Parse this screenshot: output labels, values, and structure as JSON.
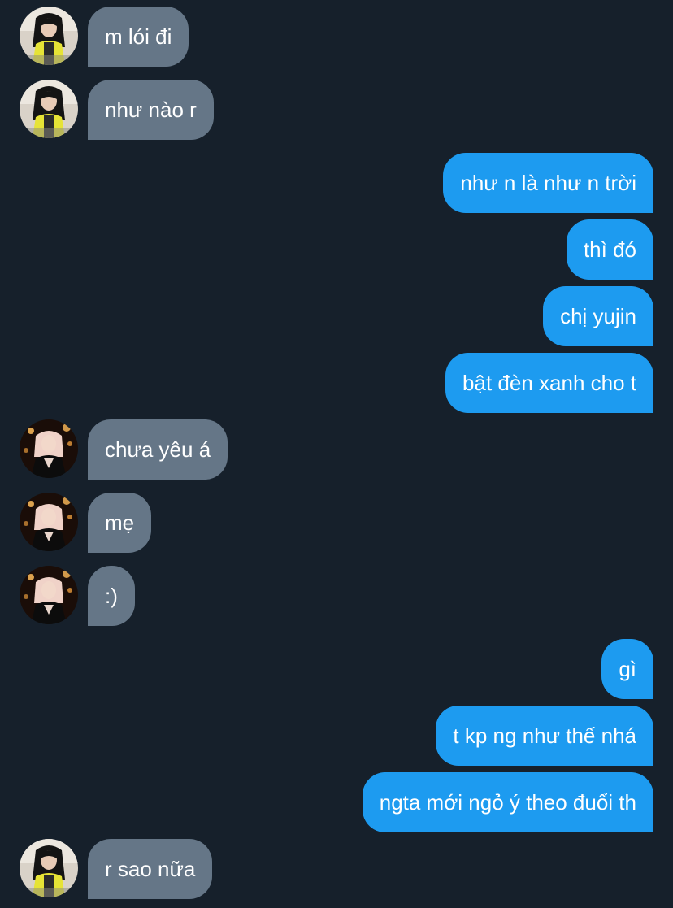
{
  "colors": {
    "background": "#16202b",
    "incoming_bubble": "#657687",
    "outgoing_bubble": "#1d9bf0",
    "text": "#ffffff"
  },
  "messages": [
    {
      "side": "in",
      "avatar": "contact-a-avatar",
      "text": "m lói đi"
    },
    {
      "side": "in",
      "avatar": "contact-a-avatar",
      "text": "như nào r"
    },
    {
      "side": "out",
      "text": "như n là như n trời"
    },
    {
      "side": "out",
      "text": "thì đó"
    },
    {
      "side": "out",
      "text": "chị yujin"
    },
    {
      "side": "out",
      "text": "bật đèn xanh cho t"
    },
    {
      "side": "in",
      "avatar": "contact-b-avatar",
      "text": "chưa yêu á"
    },
    {
      "side": "in",
      "avatar": "contact-b-avatar",
      "text": "mẹ"
    },
    {
      "side": "in",
      "avatar": "contact-b-avatar",
      "text": ":)"
    },
    {
      "side": "out",
      "text": "gì"
    },
    {
      "side": "out",
      "text": "t kp ng như thế nhá"
    },
    {
      "side": "out",
      "text": "ngta mới ngỏ ý theo đuổi th"
    },
    {
      "side": "in",
      "avatar": "contact-a-avatar",
      "text": "r sao nữa"
    }
  ]
}
